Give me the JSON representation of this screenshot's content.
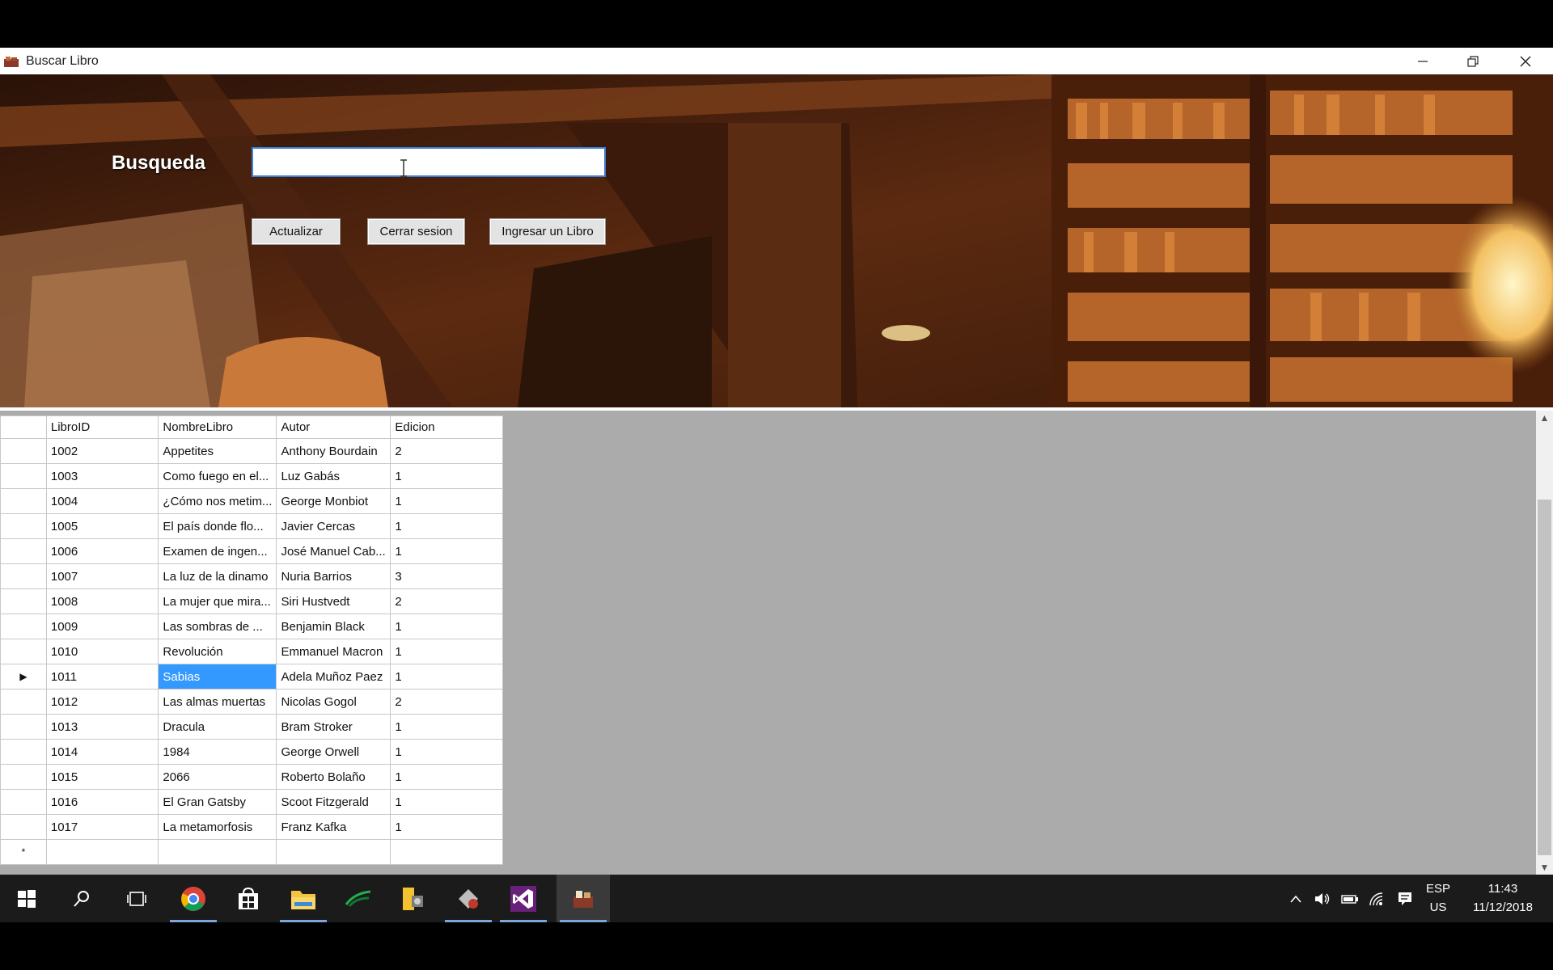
{
  "window": {
    "title": "Buscar Libro",
    "min_icon": "minimize-icon",
    "max_icon": "restore-icon",
    "close_icon": "close-icon"
  },
  "search": {
    "label": "Busqueda",
    "value": ""
  },
  "buttons": {
    "refresh": "Actualizar",
    "logout": "Cerrar sesion",
    "add_book": "Ingresar un Libro"
  },
  "grid": {
    "columns": [
      "LibroID",
      "NombreLibro",
      "Autor",
      "Edicion"
    ],
    "rows": [
      [
        "1002",
        "Appetites",
        "Anthony Bourdain",
        "2"
      ],
      [
        "1003",
        "Como fuego en el...",
        "Luz Gabás",
        "1"
      ],
      [
        "1004",
        "¿Cómo nos metim...",
        "George Monbiot",
        "1"
      ],
      [
        "1005",
        " El país donde flo...",
        "Javier Cercas",
        "1"
      ],
      [
        "1006",
        "Examen de ingen...",
        "José Manuel Cab...",
        "1"
      ],
      [
        "1007",
        "La luz de la dinamo",
        "Nuria Barrios",
        "3"
      ],
      [
        "1008",
        "La mujer que mira...",
        " Siri Hustvedt",
        "2"
      ],
      [
        "1009",
        "Las sombras de ...",
        " Benjamin Black",
        "1"
      ],
      [
        "1010",
        "Revolución",
        "Emmanuel Macron",
        "1"
      ],
      [
        "1011",
        "Sabias",
        " Adela Muñoz Paez",
        "1"
      ],
      [
        "1012",
        "Las almas muertas",
        "Nicolas Gogol",
        "2"
      ],
      [
        "1013",
        "Dracula",
        "Bram Stroker",
        "1"
      ],
      [
        "1014",
        "1984",
        "George Orwell",
        "1"
      ],
      [
        "1015",
        "2066",
        "Roberto Bolaño",
        "1"
      ],
      [
        "1016",
        "El Gran Gatsby",
        "Scoot Fitzgerald",
        "1"
      ],
      [
        "1017",
        "La metamorfosis",
        "Franz Kafka",
        "1"
      ]
    ],
    "current_row_marker": "▶",
    "new_row_marker": "*"
  },
  "taskbar": {
    "apps": [
      "start-icon",
      "search-icon",
      "task-view-icon",
      "chrome-icon",
      "store-icon",
      "file-explorer-icon",
      "app-green-icon",
      "app-tools-icon",
      "app-db-icon",
      "visual-studio-icon",
      "buscar-libro-app-icon"
    ],
    "tray": {
      "lang": "ESP",
      "region": "US",
      "time": "11:43",
      "date": "11/12/2018"
    }
  }
}
